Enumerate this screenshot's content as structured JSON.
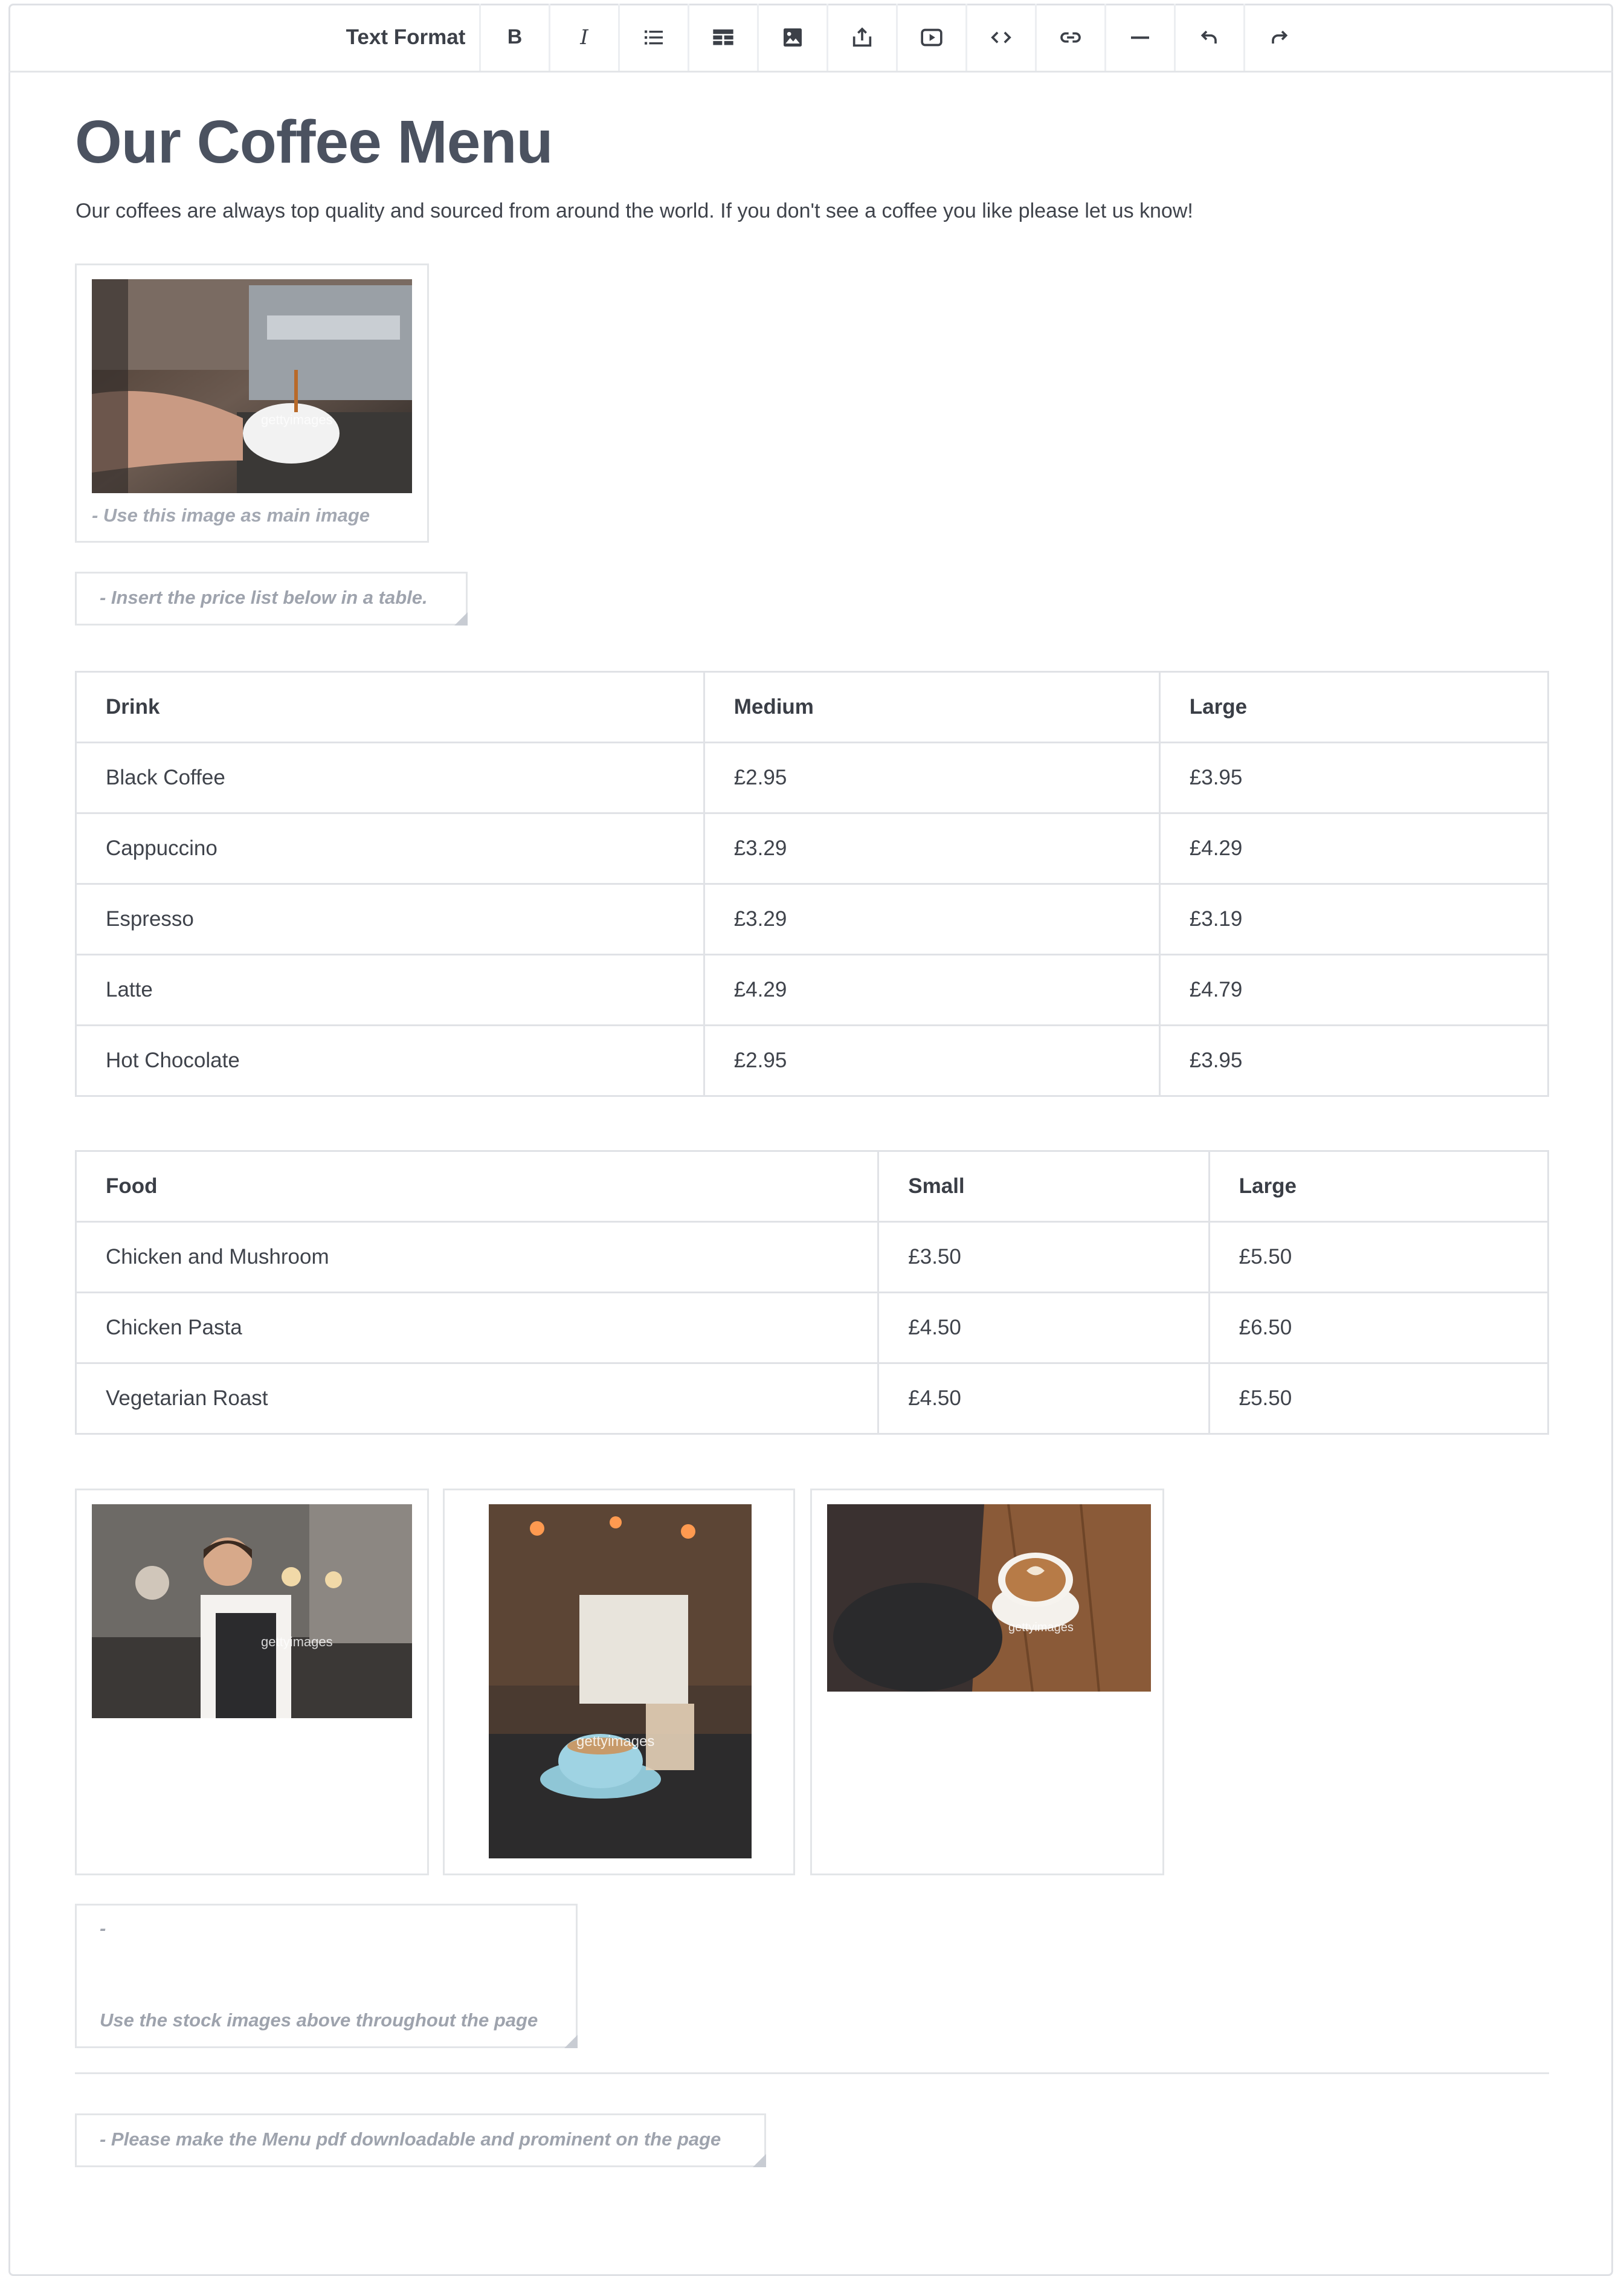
{
  "toolbar": {
    "format_label": "Text Format",
    "bold_label": "B",
    "italic_label": "I",
    "tools": [
      "bold-icon",
      "italic-icon",
      "list-icon",
      "table-icon",
      "image-icon",
      "upload-icon",
      "video-icon",
      "code-icon",
      "link-icon",
      "horizontal-rule-icon",
      "undo-icon",
      "redo-icon"
    ]
  },
  "content": {
    "title": "Our Coffee Menu",
    "intro": "Our coffees are always top quality and sourced from around the world. If you don't see a coffee you like please let us know!",
    "main_image_caption": "- Use this image as main image",
    "price_note": "- Insert the price list below in a table.",
    "stock_note_dash": "-",
    "stock_note": "Use the stock images above throughout the page",
    "pdf_note": "- Please make the Menu pdf downloadable and prominent on the page",
    "watermark": "gettyimages"
  },
  "drinks_table": {
    "headers": [
      "Drink",
      "Medium",
      "Large"
    ],
    "rows": [
      [
        "Black Coffee",
        "£2.95",
        "£3.95"
      ],
      [
        "Cappuccino",
        "£3.29",
        "£4.29"
      ],
      [
        "Espresso",
        "£3.29",
        "£3.19"
      ],
      [
        "Latte",
        "£4.29",
        "£4.79"
      ],
      [
        "Hot Chocolate",
        "£2.95",
        "£3.95"
      ]
    ]
  },
  "food_table": {
    "headers": [
      "Food",
      "Small",
      "Large"
    ],
    "rows": [
      [
        "Chicken and Mushroom",
        "£3.50",
        "£5.50"
      ],
      [
        "Chicken Pasta",
        "£4.50",
        "£6.50"
      ],
      [
        "Vegetarian Roast",
        "£4.50",
        "£5.50"
      ]
    ]
  }
}
